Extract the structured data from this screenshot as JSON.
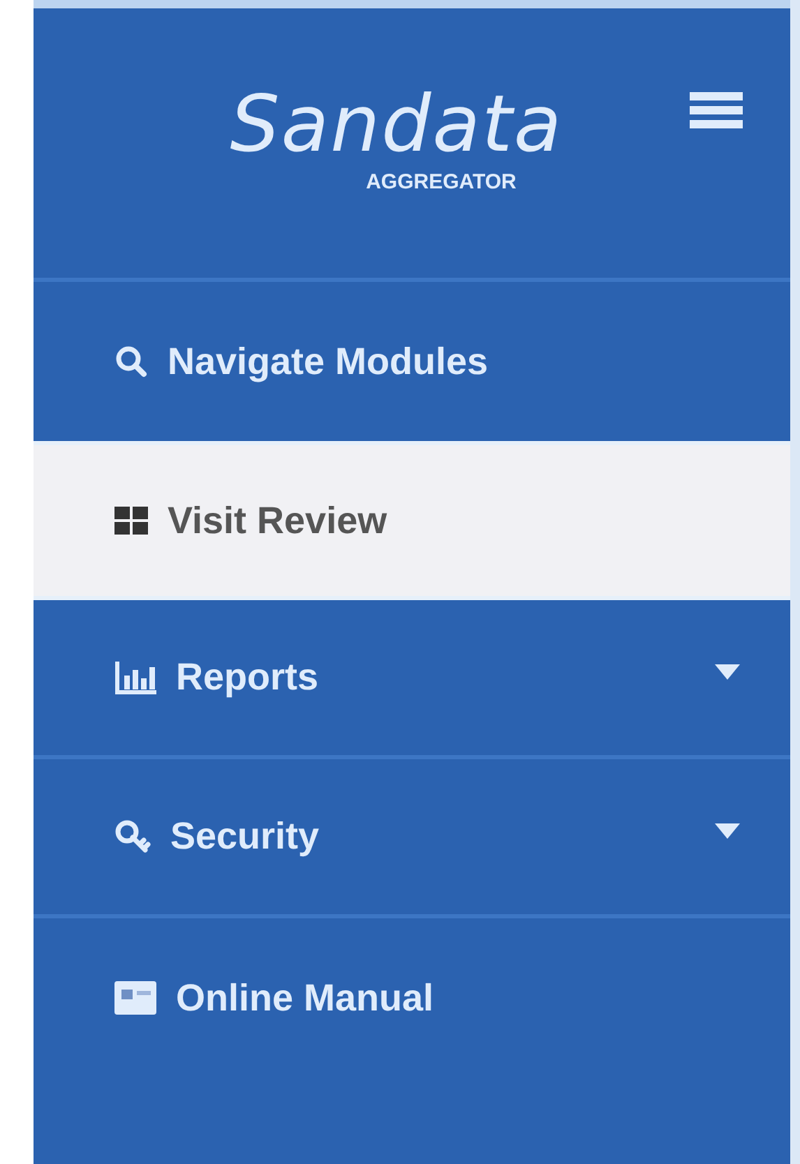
{
  "logo": {
    "name": "Sandata",
    "subtitle": "AGGREGATOR"
  },
  "nav_items": [
    {
      "label": "Navigate Modules",
      "selected": false,
      "expandable": false
    },
    {
      "label": "Visit Review",
      "selected": true,
      "expandable": false
    },
    {
      "label": "Reports",
      "selected": false,
      "expandable": true
    },
    {
      "label": "Security",
      "selected": false,
      "expandable": true
    },
    {
      "label": "Online Manual",
      "selected": false,
      "expandable": false
    }
  ]
}
